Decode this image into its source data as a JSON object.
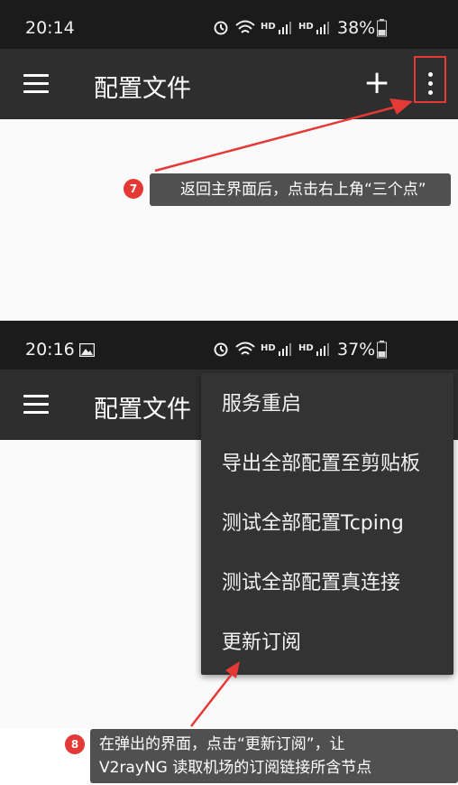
{
  "screen1": {
    "status": {
      "time": "20:14",
      "battery": "38%",
      "net_hd_1": "HD",
      "net_hd_2": "HD"
    },
    "appbar": {
      "title": "配置文件",
      "add_icon": "+",
      "overflow_icon": "more-vert-icon"
    },
    "annotation": {
      "step": "7",
      "text": "返回主界面后，点击右上角“三个点”"
    }
  },
  "screen2": {
    "status": {
      "time": "20:16",
      "battery": "37%",
      "net_hd_1": "HD",
      "net_hd_2": "HD"
    },
    "appbar": {
      "title": "配置文件"
    },
    "menu": {
      "items": [
        {
          "label": "服务重启"
        },
        {
          "label": "导出全部配置至剪贴板"
        },
        {
          "label": "测试全部配置Tcping"
        },
        {
          "label": "测试全部配置真连接"
        },
        {
          "label": "更新订阅"
        }
      ]
    },
    "annotation": {
      "step": "8",
      "line1": "在弹出的界面，点击“更新订阅”，让",
      "line2": "V2rayNG 读取机场的订阅链接所含节点"
    }
  },
  "colors": {
    "status_bar": "#1b1b1b",
    "app_bar": "#2e2e2e",
    "menu_bg": "#333333",
    "annotation_red": "#e53935",
    "tooltip_bg": "#505050"
  }
}
